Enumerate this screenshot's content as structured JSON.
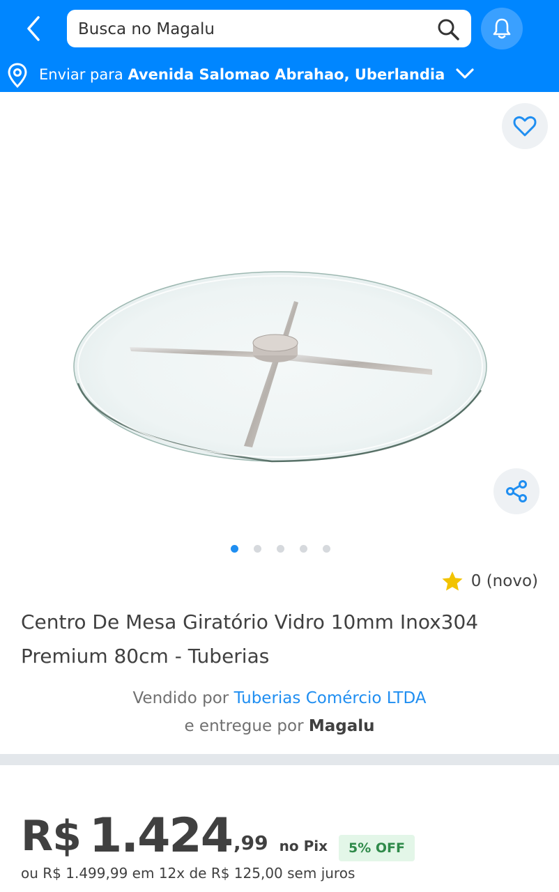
{
  "header": {
    "search_placeholder": "Busca no Magalu"
  },
  "address": {
    "prefix": "Enviar para",
    "location": "Avenida Salomao Abrahao, Uberlandia"
  },
  "gallery": {
    "total_images": 5,
    "active_index": 0
  },
  "rating": {
    "text": "0 (novo)"
  },
  "product": {
    "title": "Centro De Mesa Giratório Vidro 10mm Inox304 Premium 80cm - Tuberias"
  },
  "seller": {
    "sold_by_prefix": "Vendido por",
    "sold_by": "Tuberias Comércio LTDA",
    "delivered_by_prefix": "e entregue por",
    "delivered_by": "Magalu"
  },
  "price": {
    "currency": "R$",
    "amount": "1.424",
    "cents": ",99",
    "method": "no Pix",
    "discount_badge": "5% OFF",
    "installments": "ou R$ 1.499,99 em 12x de R$ 125,00 sem juros"
  },
  "colors": {
    "brand_blue": "#0086ff",
    "link_blue": "#1f8ef1",
    "discount_green": "#2f8a4a"
  },
  "icons": {
    "back": "chevron-left-icon",
    "search": "search-icon",
    "notifications": "bell-icon",
    "location": "map-pin-icon",
    "address_expand": "chevron-down-icon",
    "favorite": "heart-icon",
    "share": "share-icon",
    "rating": "star-icon"
  }
}
